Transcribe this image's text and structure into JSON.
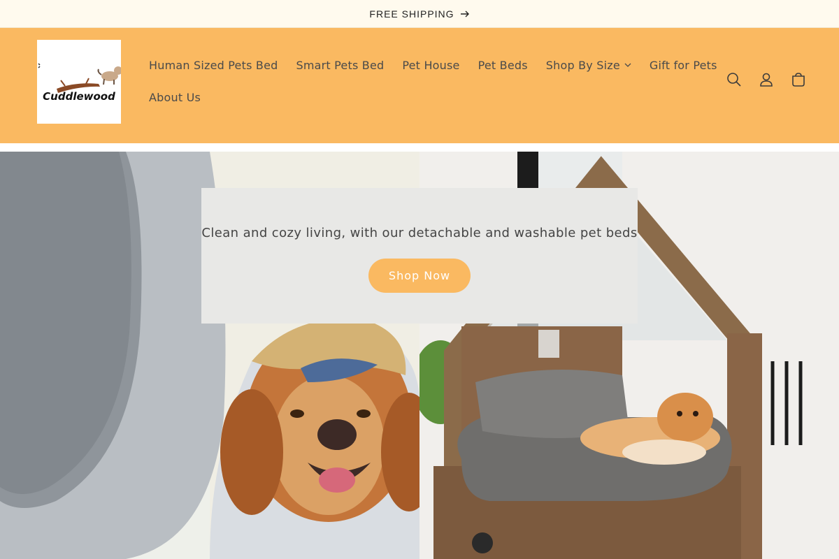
{
  "announcement": {
    "text": "FREE SHIPPING",
    "arrow_icon": "arrow-right-icon"
  },
  "brand": {
    "logo_text": "Cuddlewood"
  },
  "nav": {
    "row1": [
      {
        "label": "Human Sized Pets Bed"
      },
      {
        "label": "Smart Pets Bed"
      },
      {
        "label": "Pet House"
      },
      {
        "label": "Pet Beds"
      },
      {
        "label": "Shop By Size",
        "has_dropdown": true
      },
      {
        "label": "Gift for Pets"
      }
    ],
    "row2": [
      {
        "label": "About Us"
      }
    ]
  },
  "header_icons": [
    "search-icon",
    "account-icon",
    "cart-icon"
  ],
  "hero": {
    "text": "Clean and cozy living, with our detachable and washable pet beds",
    "button_label": "Shop Now"
  },
  "colors": {
    "accent": "#fab961",
    "announcement_bg": "#fffaee",
    "callout_bg": "#e8e8e6"
  }
}
